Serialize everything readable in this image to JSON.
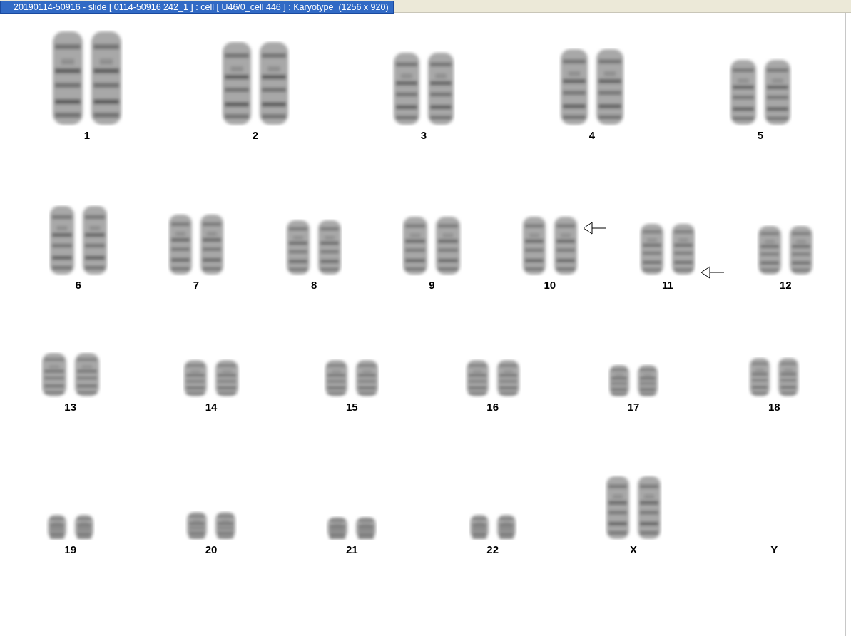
{
  "window": {
    "title": "20190114-50916 - slide [ 0114-50916 242_1 ] : cell [ U46/0_cell 446 ] : Karyotype  (1256 x 920)"
  },
  "karyotype": {
    "rows": [
      {
        "pairs": [
          {
            "label": "1",
            "kind": "pair",
            "arrow_top": false,
            "arrow_bottom": false
          },
          {
            "label": "2",
            "kind": "pair",
            "arrow_top": false,
            "arrow_bottom": false
          },
          {
            "label": "3",
            "kind": "pair",
            "arrow_top": false,
            "arrow_bottom": false
          },
          {
            "label": "4",
            "kind": "pair",
            "arrow_top": false,
            "arrow_bottom": false
          },
          {
            "label": "5",
            "kind": "pair",
            "arrow_top": false,
            "arrow_bottom": false
          }
        ]
      },
      {
        "pairs": [
          {
            "label": "6",
            "kind": "pair",
            "arrow_top": false,
            "arrow_bottom": false
          },
          {
            "label": "7",
            "kind": "pair",
            "arrow_top": false,
            "arrow_bottom": false
          },
          {
            "label": "8",
            "kind": "pair",
            "arrow_top": false,
            "arrow_bottom": false
          },
          {
            "label": "9",
            "kind": "pair",
            "arrow_top": false,
            "arrow_bottom": false
          },
          {
            "label": "10",
            "kind": "pair",
            "arrow_top": true,
            "arrow_bottom": false
          },
          {
            "label": "11",
            "kind": "pair",
            "arrow_top": false,
            "arrow_bottom": true
          },
          {
            "label": "12",
            "kind": "pair",
            "arrow_top": false,
            "arrow_bottom": false
          }
        ]
      },
      {
        "pairs": [
          {
            "label": "13",
            "kind": "pair",
            "arrow_top": false,
            "arrow_bottom": false
          },
          {
            "label": "14",
            "kind": "pair",
            "arrow_top": false,
            "arrow_bottom": false
          },
          {
            "label": "15",
            "kind": "pair",
            "arrow_top": false,
            "arrow_bottom": false
          },
          {
            "label": "16",
            "kind": "pair",
            "arrow_top": false,
            "arrow_bottom": false
          },
          {
            "label": "17",
            "kind": "pair",
            "arrow_top": false,
            "arrow_bottom": false
          },
          {
            "label": "18",
            "kind": "pair",
            "arrow_top": false,
            "arrow_bottom": false
          }
        ]
      },
      {
        "pairs": [
          {
            "label": "19",
            "kind": "pair",
            "arrow_top": false,
            "arrow_bottom": false
          },
          {
            "label": "20",
            "kind": "pair",
            "arrow_top": false,
            "arrow_bottom": false
          },
          {
            "label": "21",
            "kind": "pair",
            "arrow_top": false,
            "arrow_bottom": false
          },
          {
            "label": "22",
            "kind": "pair",
            "arrow_top": false,
            "arrow_bottom": false
          },
          {
            "label": "X",
            "kind": "pair",
            "arrow_top": false,
            "arrow_bottom": false
          },
          {
            "label": "Y",
            "kind": "empty",
            "arrow_top": false,
            "arrow_bottom": false
          }
        ]
      }
    ]
  }
}
